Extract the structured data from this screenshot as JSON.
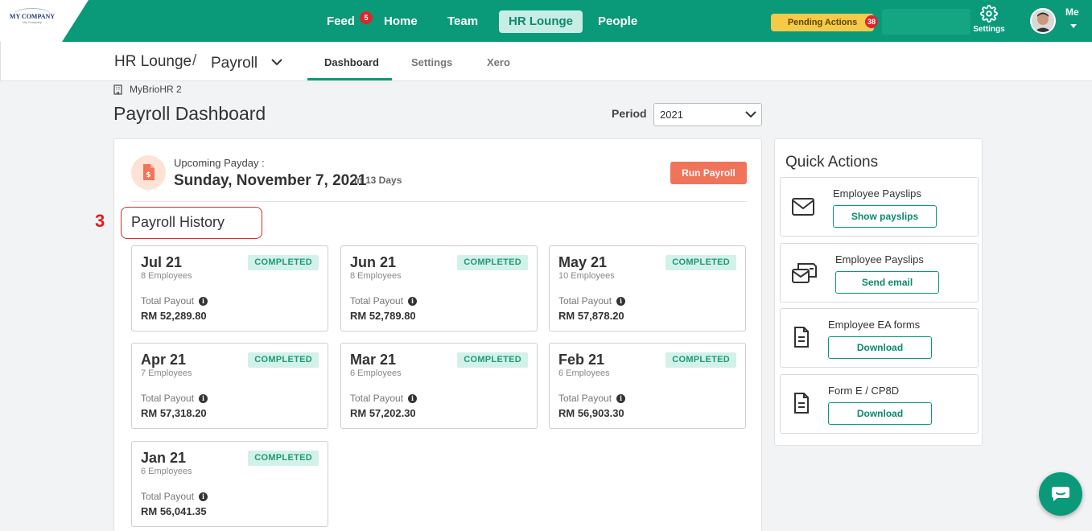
{
  "topbar": {
    "logo_text": "MY COMPANY",
    "logo_sub": "My Company",
    "nav": [
      {
        "label": "Feed",
        "badge": "5"
      },
      {
        "label": "Home"
      },
      {
        "label": "Team"
      },
      {
        "label": "HR Lounge",
        "active": true
      },
      {
        "label": "People"
      }
    ],
    "pending_label": "Pending Actions",
    "pending_count": "38",
    "settings_label": "Settings",
    "me_label": "Me"
  },
  "subbar": {
    "crumb_root": "HR Lounge",
    "crumb_sep": "/",
    "crumb_current": "Payroll",
    "tabs": [
      "Dashboard",
      "Settings",
      "Xero"
    ],
    "active_tab": "Dashboard"
  },
  "page": {
    "company": "MyBrioHR 2",
    "title": "Payroll Dashboard",
    "period_label": "Period",
    "period_value": "2021"
  },
  "payday": {
    "label": "Upcoming Payday :",
    "date": "Sunday, November 7, 2021",
    "in_days": "in 13 Days",
    "run_button": "Run Payroll"
  },
  "history": {
    "step_number": "3",
    "title": "Payroll History",
    "total_payout_label": "Total Payout",
    "cards": [
      {
        "month": "Jul 21",
        "employees": "8 Employees",
        "status": "COMPLETED",
        "amount": "RM 52,289.80"
      },
      {
        "month": "Jun 21",
        "employees": "8 Employees",
        "status": "COMPLETED",
        "amount": "RM 52,789.80"
      },
      {
        "month": "May 21",
        "employees": "10 Employees",
        "status": "COMPLETED",
        "amount": "RM 57,878.20"
      },
      {
        "month": "Apr 21",
        "employees": "7 Employees",
        "status": "COMPLETED",
        "amount": "RM 57,318.20"
      },
      {
        "month": "Mar 21",
        "employees": "6 Employees",
        "status": "COMPLETED",
        "amount": "RM 57,202.30"
      },
      {
        "month": "Feb 21",
        "employees": "6 Employees",
        "status": "COMPLETED",
        "amount": "RM 56,903.30"
      },
      {
        "month": "Jan 21",
        "employees": "6 Employees",
        "status": "COMPLETED",
        "amount": "RM 56,041.35"
      }
    ]
  },
  "quick_actions": {
    "title": "Quick Actions",
    "items": [
      {
        "label": "Employee Payslips",
        "button": "Show payslips",
        "icon": "envelope-icon"
      },
      {
        "label": "Employee Payslips",
        "button": "Send email",
        "icon": "send-mail-icon"
      },
      {
        "label": "Employee EA forms",
        "button": "Download",
        "icon": "document-icon"
      },
      {
        "label": "Form E / CP8D",
        "button": "Download",
        "icon": "document-icon"
      }
    ]
  },
  "colors": {
    "brand": "#0a9a7a",
    "run_payroll": "#f0745a",
    "pending": "#f7c948",
    "badge": "#d9282f",
    "annotation": "#e31b1b"
  }
}
